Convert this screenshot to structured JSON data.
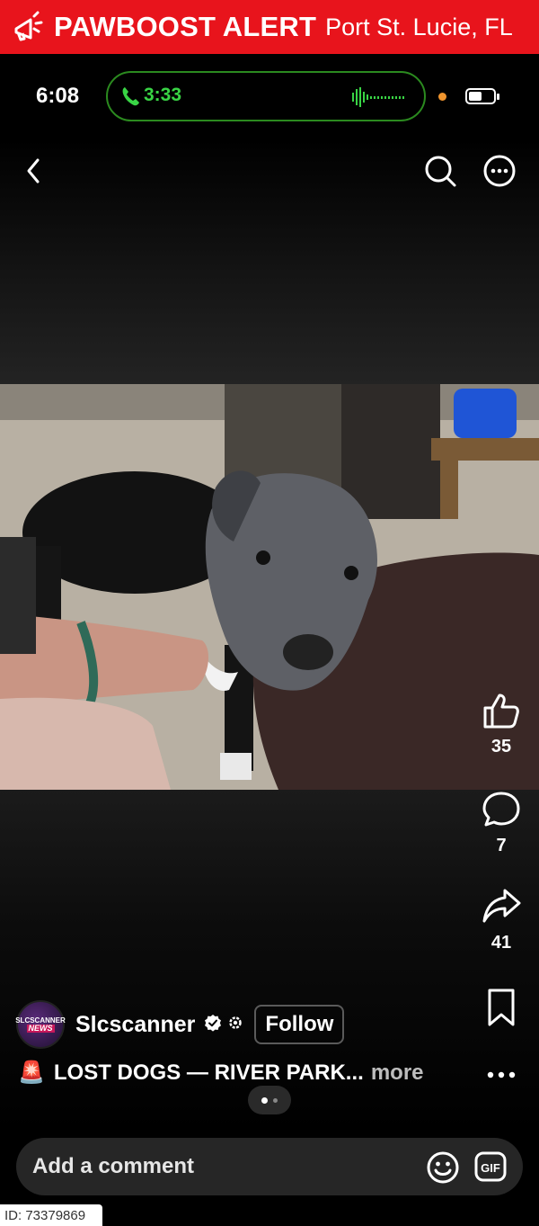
{
  "alert": {
    "title": "PAWBOOST ALERT",
    "location": "Port St. Lucie, FL",
    "icon": "megaphone-icon"
  },
  "status_bar": {
    "time": "6:08",
    "call_duration": "3:33",
    "call_color": "#39d445",
    "battery_level": 0.55
  },
  "nav": {
    "back_icon": "chevron-left-icon",
    "search_icon": "search-icon",
    "more_icon": "more-circle-icon"
  },
  "actions": {
    "likes": "35",
    "comments": "7",
    "shares": "41"
  },
  "post": {
    "avatar_line1": "SLCSCANNER",
    "avatar_line2": "NEWS",
    "username": "Slcscanner",
    "follow_label": "Follow",
    "caption_emoji": "🚨",
    "caption_text": "LOST DOGS — RIVER PARK...",
    "more_label": "more",
    "page_count": 2,
    "current_page": 1
  },
  "comment": {
    "placeholder": "Add a comment",
    "gif_label": "GIF"
  },
  "watermark": {
    "id_text": "ID: 73379869"
  },
  "colors": {
    "alert_red": "#e8141c",
    "call_border": "#2b8a1f",
    "recording_dot": "#f0952e",
    "comment_bg": "#262626"
  }
}
